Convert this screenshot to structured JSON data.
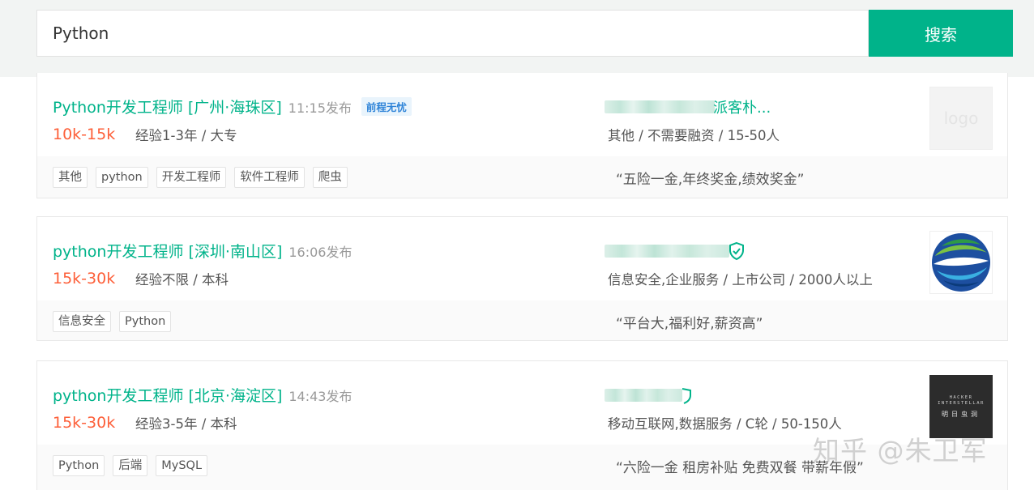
{
  "search": {
    "value": "Python",
    "button_label": "搜索"
  },
  "jobs": [
    {
      "title": "Python开发工程师 [广州·海珠区]",
      "publish_time": "11:15发布",
      "source_badge": "前程无忧",
      "salary": "10k-15k",
      "requirement": "经验1-3年 / 大专",
      "company_name_visible": "派客朴...",
      "company_info": "其他 / 不需要融资 / 15-50人",
      "logo_placeholder": "logo",
      "tags": [
        "其他",
        "python",
        "开发工程师",
        "软件工程师",
        "爬虫"
      ],
      "benefits": "“五险一金,年终奖金,绩效奖金”"
    },
    {
      "title": "python开发工程师 [深圳·南山区]",
      "publish_time": "16:06发布",
      "salary": "15k-30k",
      "requirement": "经验不限 / 本科",
      "company_info": "信息安全,企业服务 / 上市公司 / 2000人以上",
      "tags": [
        "信息安全",
        "Python"
      ],
      "benefits": "“平台大,福利好,薪资高”"
    },
    {
      "title": "python开发工程师 [北京·海淀区]",
      "publish_time": "14:43发布",
      "salary": "15k-30k",
      "requirement": "经验3-5年 / 本科",
      "company_info": "移动互联网,数据服务 / C轮 / 50-150人",
      "logo_text": {
        "line1": "HACKER",
        "line2": "INTERSTELLAR",
        "line3": "明日虫洞"
      },
      "tags": [
        "Python",
        "后端",
        "MySQL"
      ],
      "benefits": "“六险一金 租房补贴 免费双餐 带薪年假”"
    }
  ],
  "watermark": "知乎 @朱卫军",
  "colors": {
    "accent_green": "#00b38a",
    "salary_orange": "#fd5f39",
    "badge_blue": "#2f84d8"
  }
}
